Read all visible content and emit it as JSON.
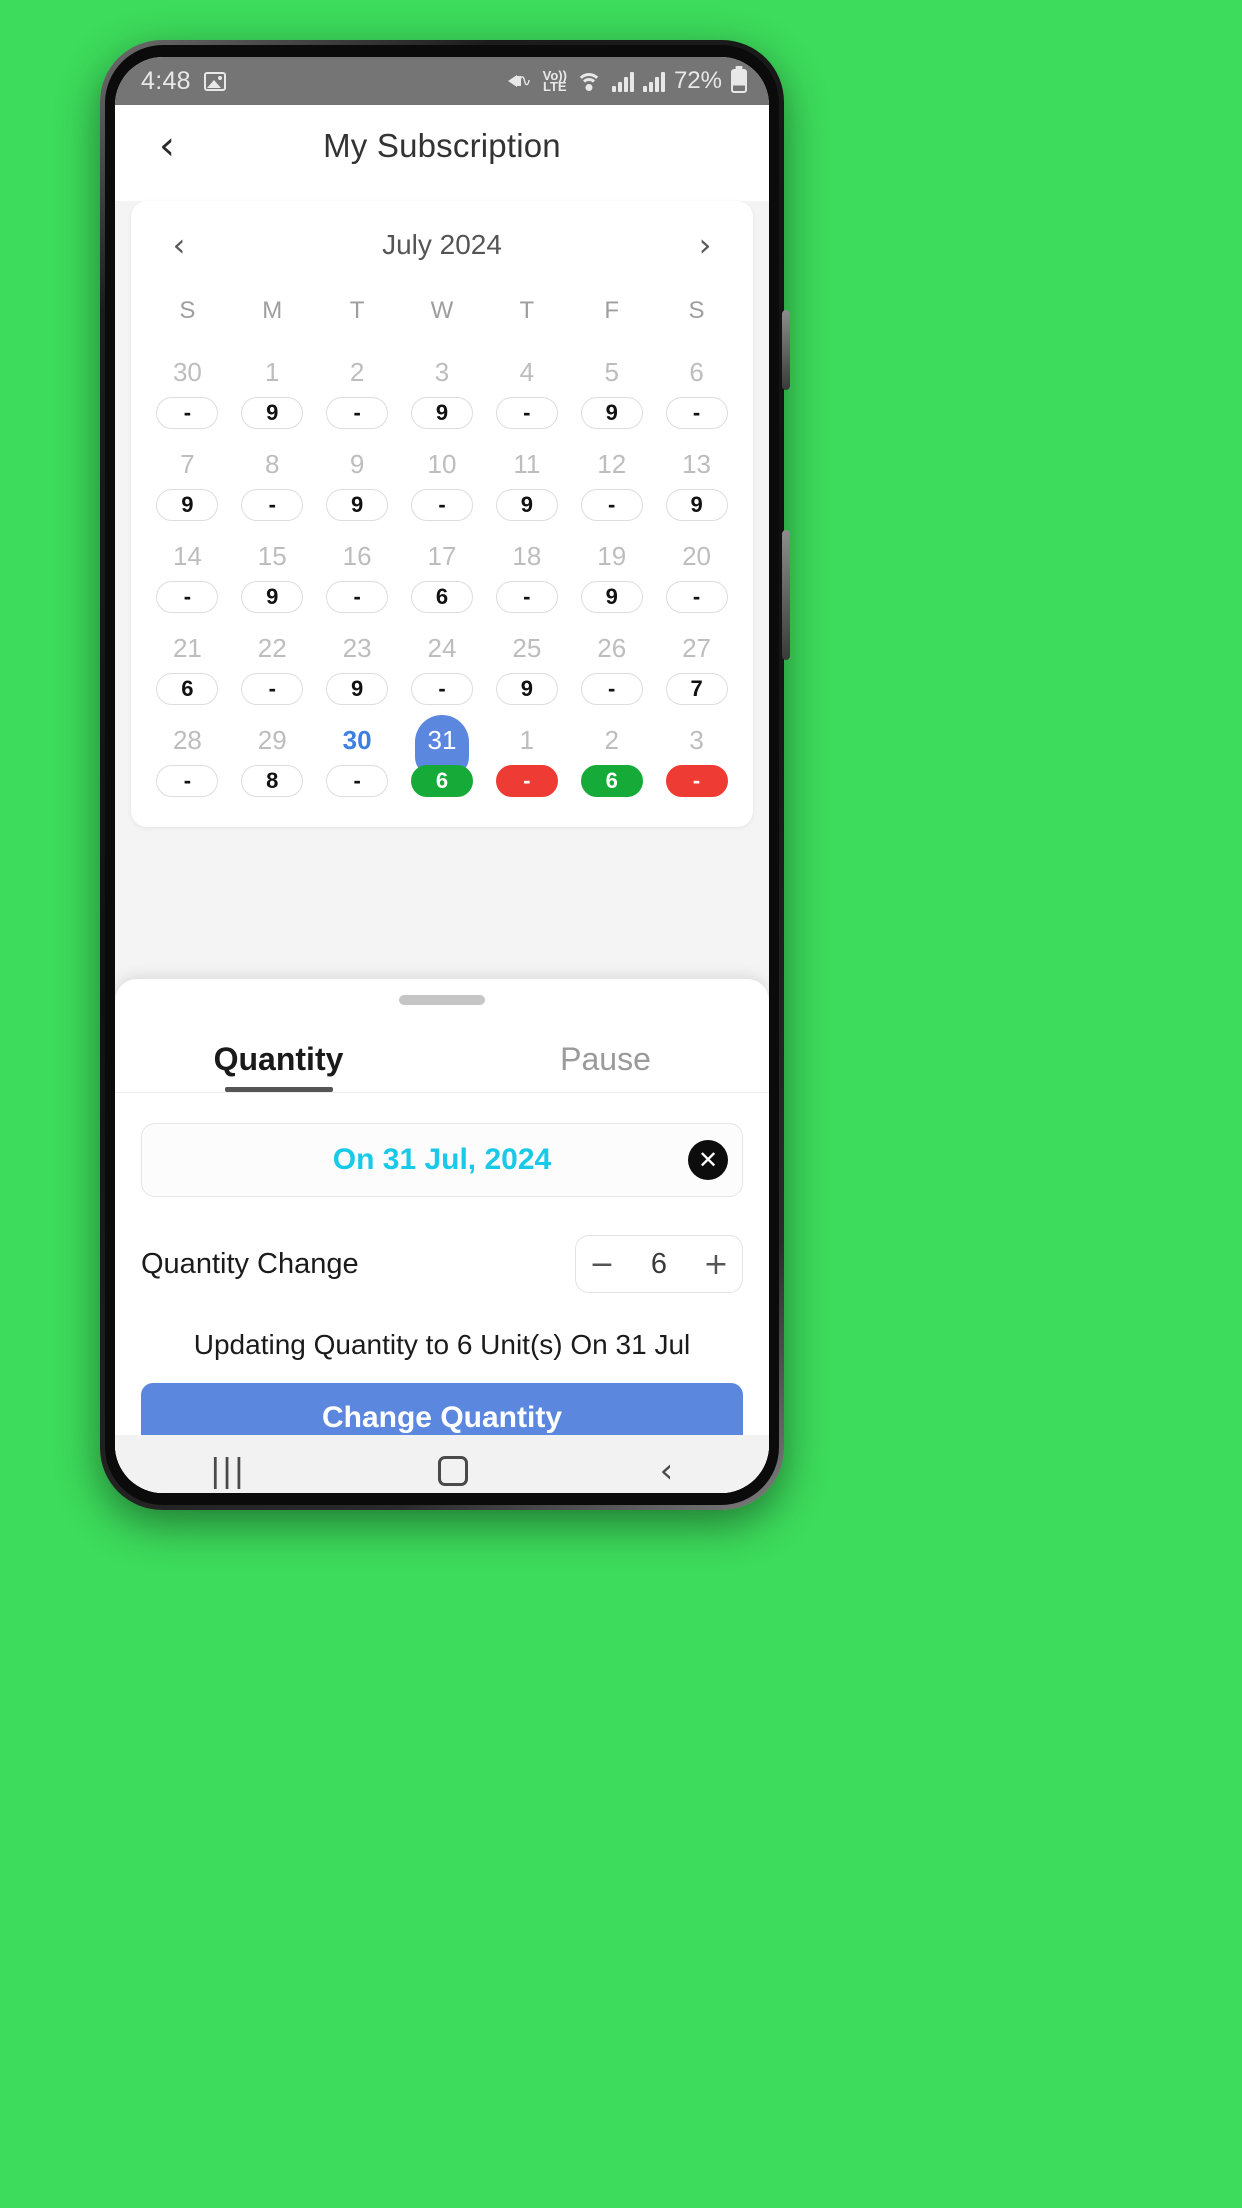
{
  "statusbar": {
    "time": "4:48",
    "battery_text": "72%",
    "volte_line1": "Vo))",
    "volte_line2": "LTE",
    "icons": [
      "image-icon",
      "mute-vibrate-icon",
      "volte-icon",
      "wifi-icon",
      "signal-icon",
      "signal-icon",
      "battery-icon"
    ]
  },
  "header": {
    "title": "My Subscription",
    "back_label": "‹"
  },
  "calendar": {
    "month_label": "July 2024",
    "prev_label": "‹",
    "next_label": "›",
    "weekdays": [
      "S",
      "M",
      "T",
      "W",
      "T",
      "F",
      "S"
    ],
    "weeks": [
      [
        {
          "day": "30",
          "badge": "-",
          "state": "out",
          "badge_style": "plain"
        },
        {
          "day": "1",
          "badge": "9",
          "state": "in",
          "badge_style": "plain"
        },
        {
          "day": "2",
          "badge": "-",
          "state": "in",
          "badge_style": "plain"
        },
        {
          "day": "3",
          "badge": "9",
          "state": "in",
          "badge_style": "plain"
        },
        {
          "day": "4",
          "badge": "-",
          "state": "in",
          "badge_style": "plain"
        },
        {
          "day": "5",
          "badge": "9",
          "state": "in",
          "badge_style": "plain"
        },
        {
          "day": "6",
          "badge": "-",
          "state": "in",
          "badge_style": "plain"
        }
      ],
      [
        {
          "day": "7",
          "badge": "9",
          "state": "in",
          "badge_style": "plain"
        },
        {
          "day": "8",
          "badge": "-",
          "state": "in",
          "badge_style": "plain"
        },
        {
          "day": "9",
          "badge": "9",
          "state": "in",
          "badge_style": "plain"
        },
        {
          "day": "10",
          "badge": "-",
          "state": "in",
          "badge_style": "plain"
        },
        {
          "day": "11",
          "badge": "9",
          "state": "in",
          "badge_style": "plain"
        },
        {
          "day": "12",
          "badge": "-",
          "state": "in",
          "badge_style": "plain"
        },
        {
          "day": "13",
          "badge": "9",
          "state": "in",
          "badge_style": "plain"
        }
      ],
      [
        {
          "day": "14",
          "badge": "-",
          "state": "in",
          "badge_style": "plain"
        },
        {
          "day": "15",
          "badge": "9",
          "state": "in",
          "badge_style": "plain"
        },
        {
          "day": "16",
          "badge": "-",
          "state": "in",
          "badge_style": "plain"
        },
        {
          "day": "17",
          "badge": "6",
          "state": "in",
          "badge_style": "plain"
        },
        {
          "day": "18",
          "badge": "-",
          "state": "in",
          "badge_style": "plain"
        },
        {
          "day": "19",
          "badge": "9",
          "state": "in",
          "badge_style": "plain"
        },
        {
          "day": "20",
          "badge": "-",
          "state": "in",
          "badge_style": "plain"
        }
      ],
      [
        {
          "day": "21",
          "badge": "6",
          "state": "in",
          "badge_style": "plain"
        },
        {
          "day": "22",
          "badge": "-",
          "state": "in",
          "badge_style": "plain"
        },
        {
          "day": "23",
          "badge": "9",
          "state": "in",
          "badge_style": "plain"
        },
        {
          "day": "24",
          "badge": "-",
          "state": "in",
          "badge_style": "plain"
        },
        {
          "day": "25",
          "badge": "9",
          "state": "in",
          "badge_style": "plain"
        },
        {
          "day": "26",
          "badge": "-",
          "state": "in",
          "badge_style": "plain"
        },
        {
          "day": "27",
          "badge": "7",
          "state": "in",
          "badge_style": "plain"
        }
      ],
      [
        {
          "day": "28",
          "badge": "-",
          "state": "in",
          "badge_style": "plain"
        },
        {
          "day": "29",
          "badge": "8",
          "state": "in",
          "badge_style": "plain"
        },
        {
          "day": "30",
          "badge": "-",
          "state": "today",
          "badge_style": "plain"
        },
        {
          "day": "31",
          "badge": "6",
          "state": "selected",
          "badge_style": "green"
        },
        {
          "day": "1",
          "badge": "-",
          "state": "out",
          "badge_style": "red"
        },
        {
          "day": "2",
          "badge": "6",
          "state": "out",
          "badge_style": "green"
        },
        {
          "day": "3",
          "badge": "-",
          "state": "out",
          "badge_style": "red"
        }
      ]
    ]
  },
  "sheet": {
    "tabs": [
      {
        "label": "Quantity",
        "active": true
      },
      {
        "label": "Pause",
        "active": false
      }
    ],
    "date_chip": {
      "text": "On 31 Jul, 2024",
      "close_label": "✕"
    },
    "quantity": {
      "label": "Quantity Change",
      "minus_label": "−",
      "value": "6",
      "plus_label": "+"
    },
    "update_note": "Updating Quantity to 6 Unit(s) On 31 Jul",
    "cta_label": "Change Quantity"
  },
  "navbar": {
    "recent_label": "|||",
    "back_label": "‹"
  },
  "colors": {
    "background": "#3ddc5c",
    "accent_blue": "#5b87de",
    "cyan": "#18c9e8",
    "green": "#16ab39",
    "red": "#ee3b33",
    "today_blue": "#3f7fe0"
  }
}
